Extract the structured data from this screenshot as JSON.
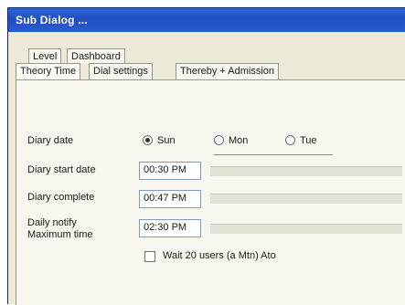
{
  "window": {
    "title": "Sub Dialog ..."
  },
  "tabs": {
    "row1": [
      "Level",
      "Dashboard"
    ],
    "row2": [
      "Theory Time",
      "Dial settings",
      "Thereby + Admission"
    ]
  },
  "form": {
    "days_label": "Diary date",
    "days": [
      "Sun",
      "Mon",
      "Tue"
    ],
    "start_label": "Diary start date",
    "start_value": "00:30 PM",
    "end_label": "Diary complete",
    "end_value": "00:47 PM",
    "time_label_1": "Daily notify",
    "time_label_2": "Maximum time",
    "time_value": "02:30 PM",
    "option_text": "Wait 20 users (a Mtn) Ato"
  }
}
